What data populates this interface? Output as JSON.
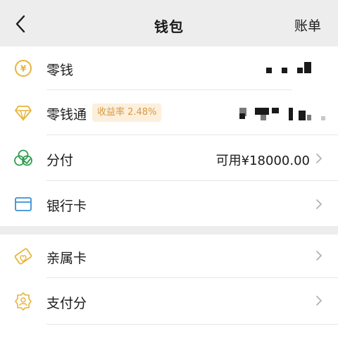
{
  "header": {
    "title": "钱包",
    "bill_label": "账单"
  },
  "wallet": {
    "change": {
      "label": "零钱",
      "icon": "yen-circle-icon"
    },
    "change_pass": {
      "label": "零钱通",
      "badge": "收益率 2.48%",
      "icon": "diamond-icon"
    },
    "installment": {
      "label": "分付",
      "value": "可用¥18000.00",
      "icon": "installment-icon"
    },
    "bank_card": {
      "label": "银行卡",
      "icon": "bank-card-icon"
    }
  },
  "services": {
    "family_card": {
      "label": "亲属卡",
      "icon": "family-card-icon"
    },
    "pay_score": {
      "label": "支付分",
      "icon": "pay-score-icon"
    }
  },
  "colors": {
    "accent_yellow": "#e8b43c",
    "accent_green": "#2ba04a",
    "accent_blue": "#3a8fd6",
    "badge_bg": "#fcefdc",
    "badge_text": "#d79a45"
  }
}
